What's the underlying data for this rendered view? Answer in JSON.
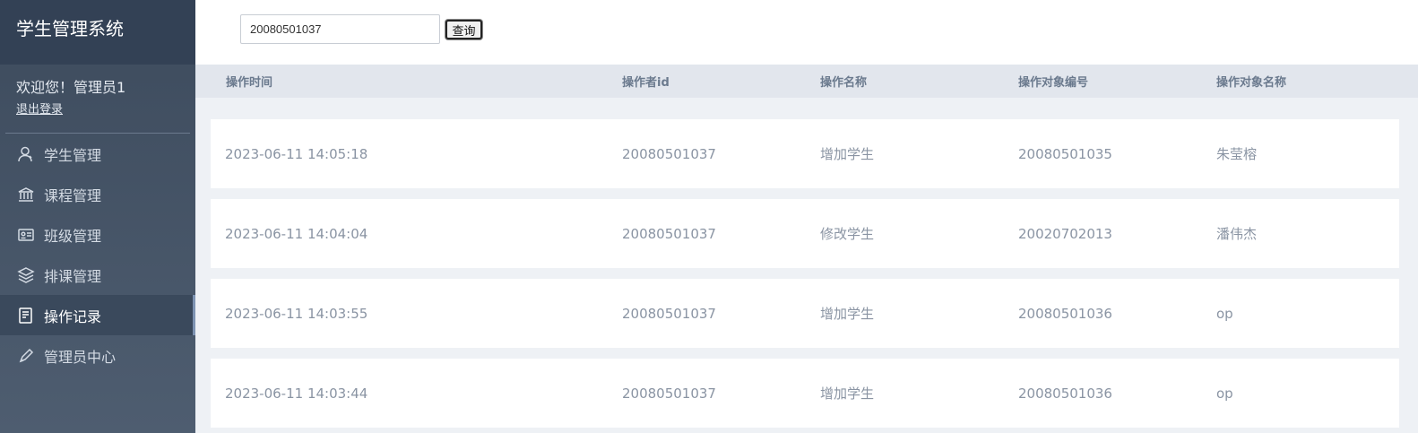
{
  "sidebar": {
    "brand": "学生管理系统",
    "welcome": "欢迎您！管理员1",
    "logout": "退出登录",
    "items": [
      {
        "label": "学生管理",
        "icon": "user-icon"
      },
      {
        "label": "课程管理",
        "icon": "bank-icon"
      },
      {
        "label": "班级管理",
        "icon": "id-card-icon"
      },
      {
        "label": "排课管理",
        "icon": "layers-icon"
      },
      {
        "label": "操作记录",
        "icon": "document-icon",
        "active": true
      },
      {
        "label": "管理员中心",
        "icon": "pen-icon"
      }
    ]
  },
  "search": {
    "value": "20080501037",
    "button": "查询"
  },
  "table": {
    "headers": [
      "操作时间",
      "操作者id",
      "操作名称",
      "操作对象编号",
      "操作对象名称"
    ],
    "rows": [
      [
        "2023-06-11 14:05:18",
        "20080501037",
        "增加学生",
        "20080501035",
        "朱莹榕"
      ],
      [
        "2023-06-11 14:04:04",
        "20080501037",
        "修改学生",
        "20020702013",
        "潘伟杰"
      ],
      [
        "2023-06-11 14:03:55",
        "20080501037",
        "增加学生",
        "20080501036",
        "op"
      ],
      [
        "2023-06-11 14:03:44",
        "20080501037",
        "增加学生",
        "20080501036",
        "op"
      ]
    ]
  },
  "colors": {
    "sidebar_top": "#334155",
    "sidebar_bg": "#4e5d70",
    "table_bg": "#eef1f5",
    "text_muted": "#8a94a3"
  }
}
